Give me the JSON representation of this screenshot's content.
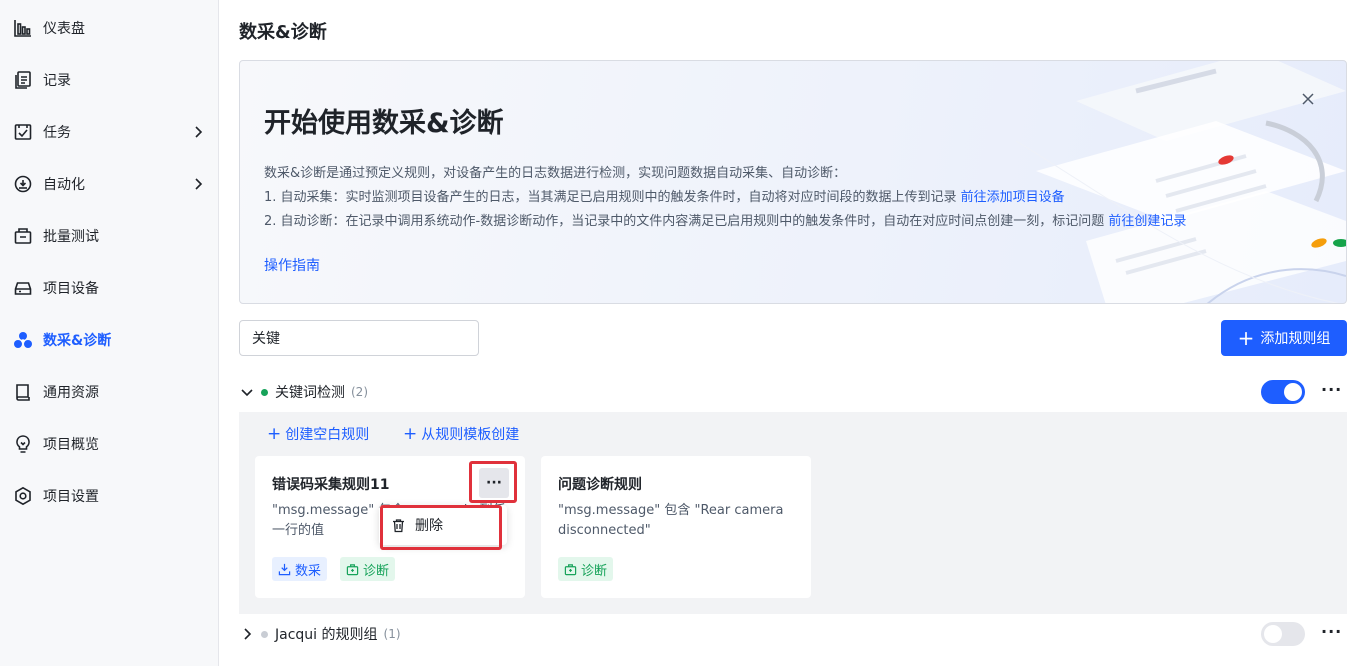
{
  "sidebar": {
    "items": [
      {
        "label": "仪表盘",
        "icon": "dashboard-icon"
      },
      {
        "label": "记录",
        "icon": "record-icon"
      },
      {
        "label": "任务",
        "icon": "task-icon",
        "has_submenu": true
      },
      {
        "label": "自动化",
        "icon": "automation-icon",
        "has_submenu": true
      },
      {
        "label": "批量测试",
        "icon": "batch-test-icon"
      },
      {
        "label": "项目设备",
        "icon": "device-icon"
      },
      {
        "label": "数采&诊断",
        "icon": "diagnosis-icon",
        "active": true
      },
      {
        "label": "通用资源",
        "icon": "resource-icon"
      },
      {
        "label": "项目概览",
        "icon": "overview-icon"
      },
      {
        "label": "项目设置",
        "icon": "settings-icon"
      }
    ]
  },
  "page": {
    "title": "数采&诊断"
  },
  "banner": {
    "title": "开始使用数采&诊断",
    "intro": "数采&诊断是通过预定义规则，对设备产生的日志数据进行检测，实现问题数据自动采集、自动诊断：",
    "line1_text": "1. 自动采集：实时监测项目设备产生的日志，当其满足已启用规则中的触发条件时，自动将对应时间段的数据上传到记录 ",
    "line1_link": "前往添加项目设备",
    "line2_text": "2. 自动诊断：在记录中调用系统动作-数据诊断动作，当记录中的文件内容满足已启用规则中的触发条件时，自动在对应时间点创建一刻，标记问题 ",
    "line2_link": "前往创建记录",
    "guide_link": "操作指南"
  },
  "search": {
    "value": "关键"
  },
  "toolbar": {
    "add_group_label": "添加规则组"
  },
  "groups": [
    {
      "name": "关键词检测",
      "count": "(2)",
      "expanded": true,
      "enabled": true,
      "actions": {
        "create_blank": "创建空白规则",
        "from_template": "从规则模板创建"
      },
      "rules": [
        {
          "title": "错误码采集规则11",
          "desc": "\"msg.message\" 包含 error code 列任一行的值",
          "tags": [
            "数采",
            "诊断"
          ]
        },
        {
          "title": "问题诊断规则",
          "desc": "\"msg.message\" 包含 \"Rear camera disconnected\"",
          "tags": [
            "诊断"
          ]
        }
      ]
    },
    {
      "name": "Jacqui 的规则组",
      "count": "(1)",
      "expanded": false,
      "enabled": false
    }
  ],
  "dropdown": {
    "items": [
      {
        "label": "删除",
        "icon": "trash-icon"
      }
    ]
  },
  "colors": {
    "primary": "#1e5eff",
    "success": "#17a35a",
    "highlight_box": "#e0313b",
    "toggle_off": "#e5e6eb"
  }
}
